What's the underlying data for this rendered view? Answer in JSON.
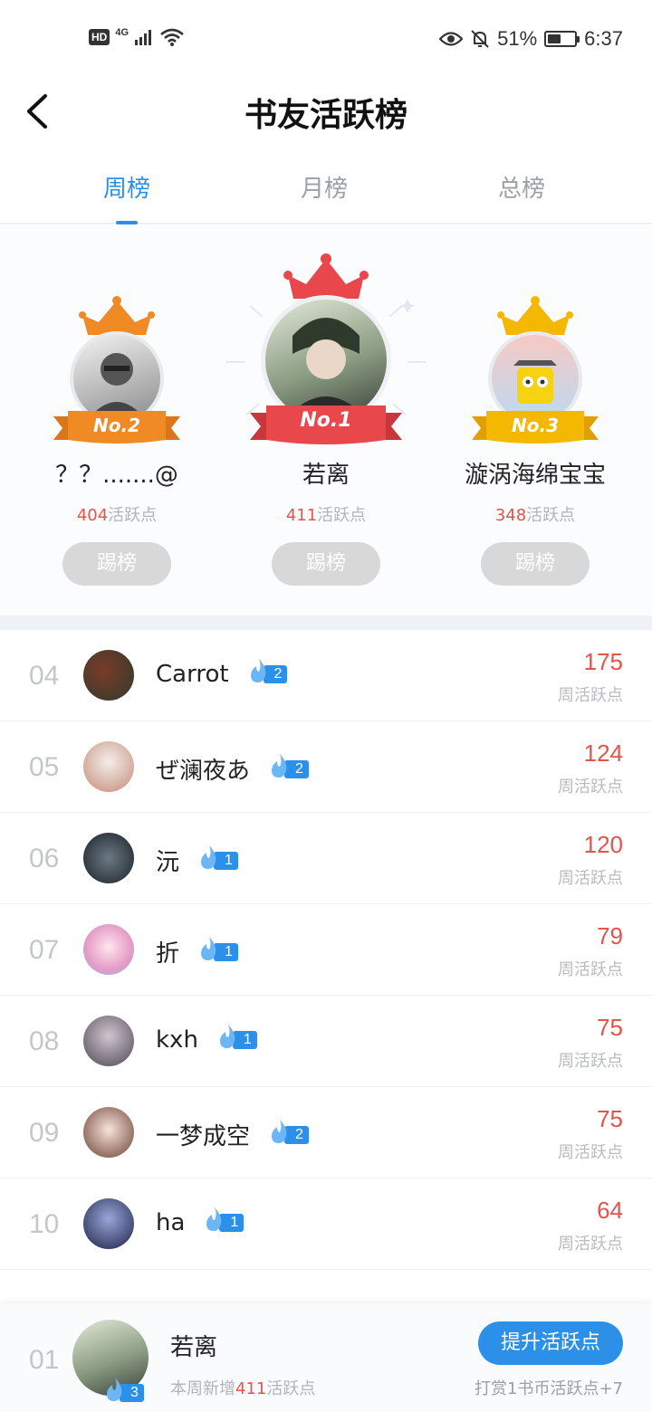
{
  "status_bar": {
    "hd": "HD",
    "network": "4G",
    "battery_percent": "51%",
    "battery_level": 0.51,
    "time": "6:37"
  },
  "header": {
    "title": "书友活跃榜"
  },
  "tabs": [
    {
      "label": "周榜",
      "active": true
    },
    {
      "label": "月榜",
      "active": false
    },
    {
      "label": "总榜",
      "active": false
    }
  ],
  "podium": {
    "first": {
      "badge": "No.1",
      "name": "若离",
      "points": "411",
      "points_suffix": "活跃点",
      "button": "踢榜"
    },
    "second": {
      "badge": "No.2",
      "name": "？？.......@",
      "points": "404",
      "points_suffix": "活跃点",
      "button": "踢榜"
    },
    "third": {
      "badge": "No.3",
      "name": "漩涡海绵宝宝",
      "points": "348",
      "points_suffix": "活跃点",
      "button": "踢榜"
    }
  },
  "list": [
    {
      "rank": "04",
      "name": "Carrot",
      "level": "2",
      "score": "175",
      "label": "周活跃点"
    },
    {
      "rank": "05",
      "name": "ぜ澜夜あ",
      "level": "2",
      "score": "124",
      "label": "周活跃点"
    },
    {
      "rank": "06",
      "name": "沅",
      "level": "1",
      "score": "120",
      "label": "周活跃点"
    },
    {
      "rank": "07",
      "name": "折",
      "level": "1",
      "score": "79",
      "label": "周活跃点"
    },
    {
      "rank": "08",
      "name": "kxh",
      "level": "1",
      "score": "75",
      "label": "周活跃点"
    },
    {
      "rank": "09",
      "name": "一梦成空",
      "level": "2",
      "score": "75",
      "label": "周活跃点"
    },
    {
      "rank": "10",
      "name": "ha",
      "level": "1",
      "score": "64",
      "label": "周活跃点"
    }
  ],
  "me": {
    "rank": "01",
    "name": "若离",
    "level": "3",
    "weekly_prefix": "本周新增",
    "weekly_points": "411",
    "weekly_suffix": "活跃点",
    "boost_button": "提升活跃点",
    "reward_note": "打赏1书币活跃点+7"
  },
  "colors": {
    "accent": "#2c90e8",
    "score": "#e5534b",
    "gold": "#f5a623",
    "silver_orange": "#f08a24",
    "red": "#e8474c"
  }
}
